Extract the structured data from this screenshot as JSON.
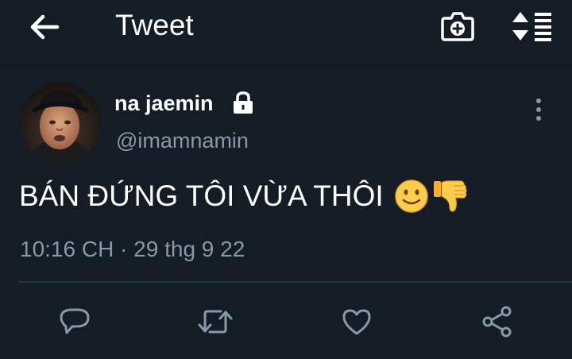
{
  "header": {
    "title": "Tweet",
    "icons": {
      "back": "arrow-left-icon",
      "camera": "camera-plus-icon",
      "sort": "sort-icon"
    }
  },
  "tweet": {
    "author": {
      "display_name": "na jaemin",
      "handle": "@imamnamin",
      "protected": true
    },
    "text": "BÁN ĐỨNG TÔI VỪA THÔI",
    "emojis": [
      "slightly-smiling-face",
      "thumbs-down"
    ],
    "timestamp": "10:16 CH · 29 thg 9 22"
  },
  "actions": [
    "reply",
    "retweet",
    "like",
    "share"
  ],
  "colors": {
    "background": "#141d26",
    "text_primary": "#ffffff",
    "text_secondary": "#8899a6",
    "divider": "#243447",
    "icon": "#8899a6",
    "emoji_yellow": "#ffcc4d"
  }
}
